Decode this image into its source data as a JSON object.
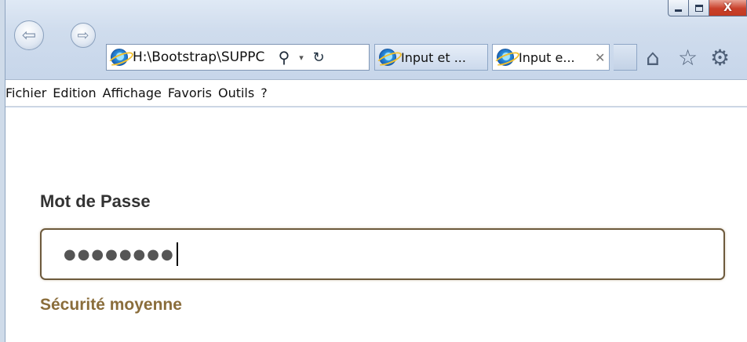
{
  "window": {
    "caption": {
      "minimize_icon": "minimize-icon",
      "maximize_icon": "maximize-icon",
      "close_glyph": "X"
    }
  },
  "nav": {
    "back_glyph": "⇦",
    "forward_glyph": "⇨",
    "address": "H:\\Bootstrap\\SUPPC",
    "search_glyph": "⚲",
    "dropdown_glyph": "▾",
    "refresh_glyph": "↻"
  },
  "tabs": [
    {
      "label": "Input et ...",
      "active": false
    },
    {
      "label": "Input e...",
      "active": true,
      "close_glyph": "✕"
    }
  ],
  "toolbar_icons": {
    "home": "⌂",
    "favorites": "☆",
    "settings": "⚙"
  },
  "menu": [
    "Fichier",
    "Edition",
    "Affichage",
    "Favoris",
    "Outils",
    "?"
  ],
  "form": {
    "label": "Mot de Passe",
    "password_masked": "●●●●●●●●",
    "strength_text": "Sécurité moyenne",
    "strength_color": "#8a6d3b",
    "field_border_color": "#6d5a3c"
  }
}
